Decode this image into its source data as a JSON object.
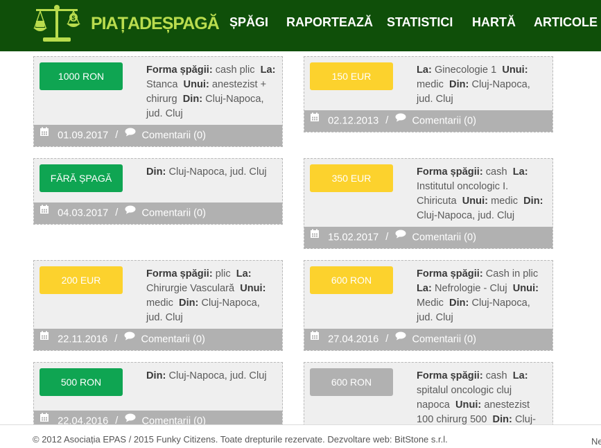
{
  "header": {
    "brand": "PIAȚADEȘPAGĂ",
    "nav": [
      {
        "label": "ȘPĂGI"
      },
      {
        "label": "RAPORTEAZĂ"
      },
      {
        "label": "STATISTICI"
      },
      {
        "label": "HARTĂ"
      },
      {
        "label": "ARTICOLE"
      }
    ]
  },
  "colors": {
    "header_bg": "#0f4f09",
    "brand": "#b9dc4e",
    "green": "#0fa552",
    "yellow": "#fcd22d",
    "gray": "#b1b1b1",
    "card_bg": "#efefef"
  },
  "labels": {
    "forma": "Forma șpăgii:",
    "la": "La:",
    "unui": "Unui:",
    "din": "Din:"
  },
  "cards": [
    {
      "price": "1000 RON",
      "price_style": "green",
      "forma": "cash plic",
      "la": "Stanca",
      "unui": "anestezist + chirurg",
      "din": "Cluj-Napoca, jud. Cluj",
      "date": "01.09.2017",
      "comments": "Comentarii (0)"
    },
    {
      "price": "150 EUR",
      "price_style": "yellow",
      "la": "Ginecologie 1",
      "unui": "medic",
      "din": "Cluj-Napoca, jud. Cluj",
      "date": "02.12.2013",
      "comments": "Comentarii (0)"
    },
    {
      "price": "FĂRĂ ȘPAGĂ",
      "price_style": "green",
      "din": "Cluj-Napoca, jud. Cluj",
      "date": "04.03.2017",
      "comments": "Comentarii (0)"
    },
    {
      "price": "350 EUR",
      "price_style": "yellow",
      "forma": "cash",
      "la": "Institutul oncologic I. Chiricuta",
      "unui": "medic",
      "din": "Cluj-Napoca, jud. Cluj",
      "date": "15.02.2017",
      "comments": "Comentarii (0)"
    },
    {
      "price": "200 EUR",
      "price_style": "yellow",
      "forma": "plic",
      "la": "Chirurgie Vasculară",
      "unui": "medic",
      "din": "Cluj-Napoca, jud. Cluj",
      "date": "22.11.2016",
      "comments": "Comentarii (0)"
    },
    {
      "price": "600 RON",
      "price_style": "yellow",
      "forma": "Cash in plic",
      "la": "Nefrologie - Cluj",
      "unui": "Medic",
      "din": "Cluj-Napoca, jud. Cluj",
      "date": "27.04.2016",
      "comments": "Comentarii (0)"
    },
    {
      "price": "500 RON",
      "price_style": "green",
      "din": "Cluj-Napoca, jud. Cluj",
      "date": "22.04.2016",
      "comments": "Comentarii (0)"
    },
    {
      "price": "600 RON",
      "price_style": "gray",
      "forma": "cash",
      "la": "spitalul oncologic cluj napoca",
      "unui": "anestezist 100 chirurg 500",
      "din": "Cluj-",
      "date": "",
      "comments": ""
    }
  ],
  "footer": {
    "copyright": "© 2012 Asociația EPAS / 2015 Funky Citizens. Toate drepturile rezervate. Dezvoltare web: BitStone s.r.l.",
    "trail": "Ne"
  }
}
